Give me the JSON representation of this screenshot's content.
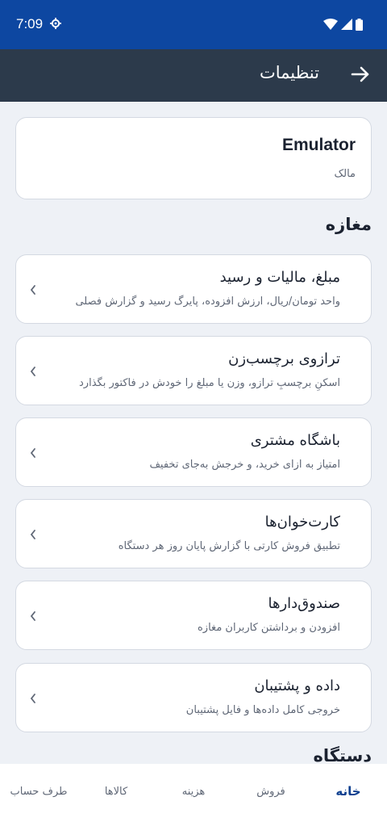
{
  "status_bar": {
    "time": "7:09",
    "icons": [
      "settings-gear-icon",
      "wifi-icon",
      "signal-icon",
      "battery-icon"
    ]
  },
  "app_bar": {
    "title": "تنظیمات",
    "back_icon": "arrow-right-icon"
  },
  "profile": {
    "name": "Emulator",
    "role": "مالک"
  },
  "sections": {
    "shop_title": "مغازه",
    "device_title": "دستگاه"
  },
  "settings": [
    {
      "title": "مبلغ، مالیات و رسید",
      "subtitle": "واحد تومان/ریال، ارزش افزوده، پایرگ رسید و گزارش فصلی"
    },
    {
      "title": "ترازوی برچسب‌زن",
      "subtitle": "اسکنِ برچسبِ ترازو، وزن یا مبلغ را خودش در فاکتور بگذارد"
    },
    {
      "title": "باشگاه مشتری",
      "subtitle": "امتیاز به ازای خرید، و خرجش به‌جای تخفیف"
    },
    {
      "title": "کارت‌خوان‌ها",
      "subtitle": "تطبیق فروش کارتی با گزارش پایان روز هر دستگاه"
    },
    {
      "title": "صندوق‌دارها",
      "subtitle": "افزودن و برداشتن کاربران مغازه"
    },
    {
      "title": "داده و پشتیبان",
      "subtitle": "خروجی کامل داده‌ها و فایل پشتیبان"
    }
  ],
  "bottom_nav": [
    {
      "label": "خانه",
      "active": true
    },
    {
      "label": "فروش",
      "active": false
    },
    {
      "label": "هزینه",
      "active": false
    },
    {
      "label": "کالاها",
      "active": false
    },
    {
      "label": "طرف حساب",
      "active": false
    }
  ],
  "colors": {
    "status_bar": "#0d47a1",
    "app_bar": "#2c3a4b",
    "background": "#eef1f6",
    "active_nav": "#0d3f8f"
  }
}
